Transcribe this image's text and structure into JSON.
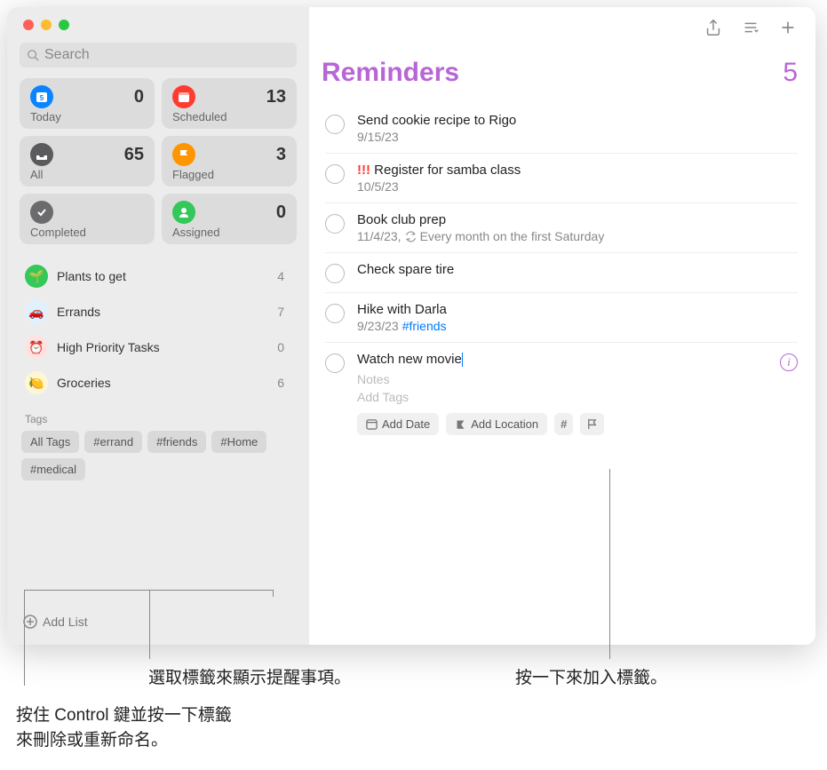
{
  "accent": "#b866d6",
  "search": {
    "placeholder": "Search"
  },
  "cards": [
    {
      "label": "Today",
      "count": "0",
      "color": "#0a84ff",
      "icon": "calendar"
    },
    {
      "label": "Scheduled",
      "count": "13",
      "color": "#ff3b30",
      "icon": "calendar"
    },
    {
      "label": "All",
      "count": "65",
      "color": "#5b5b5e",
      "icon": "tray"
    },
    {
      "label": "Flagged",
      "count": "3",
      "color": "#ff9500",
      "icon": "flag"
    },
    {
      "label": "Completed",
      "count": "",
      "color": "#6b6b6e",
      "icon": "check"
    },
    {
      "label": "Assigned",
      "count": "0",
      "color": "#34c759",
      "icon": "person"
    }
  ],
  "lists": [
    {
      "name": "Plants to get",
      "count": "4",
      "color": "#34c759",
      "emoji": "🌱"
    },
    {
      "name": "Errands",
      "count": "7",
      "color": "#5ac8fa",
      "emoji": "🚗"
    },
    {
      "name": "High Priority Tasks",
      "count": "0",
      "color": "#ff3b30",
      "emoji": "⏰"
    },
    {
      "name": "Groceries",
      "count": "6",
      "color": "#ffcc00",
      "emoji": "🍋"
    }
  ],
  "tags_section_label": "Tags",
  "tags": [
    "All Tags",
    "#errand",
    "#friends",
    "#Home",
    "#medical"
  ],
  "add_list_label": "Add List",
  "header": {
    "title": "Reminders",
    "count": "5"
  },
  "reminders": [
    {
      "title": "Send cookie recipe to Rigo",
      "sub": "9/15/23"
    },
    {
      "title": "Register for samba class",
      "sub": "10/5/23",
      "priority": "!!!"
    },
    {
      "title": "Book club prep",
      "sub": "11/4/23, ",
      "repeat": "Every month on the first Saturday"
    },
    {
      "title": "Check spare tire",
      "sub": ""
    },
    {
      "title": "Hike with Darla",
      "sub": "9/23/23 ",
      "tag": "#friends"
    },
    {
      "title": "Watch new movie",
      "editing": true,
      "notes_placeholder": "Notes",
      "tags_placeholder": "Add Tags",
      "add_date": "Add Date",
      "add_location": "Add Location"
    }
  ],
  "callouts": {
    "c1": "選取標籤來顯示提醒事項。",
    "c2": "按一下來加入標籤。",
    "c3a": "按住 Control 鍵並按一下標籤",
    "c3b": "來刪除或重新命名。"
  }
}
